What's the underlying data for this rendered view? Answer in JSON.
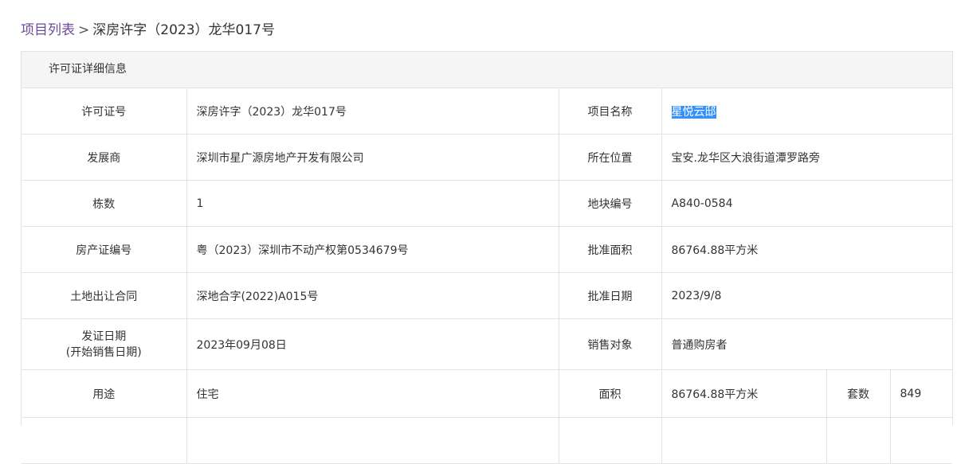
{
  "breadcrumb": {
    "link": "项目列表",
    "separator": ">",
    "current": "深房许字（2023）龙华017号"
  },
  "panel": {
    "title": "许可证详细信息"
  },
  "rows": {
    "permit_no": {
      "label": "许可证号",
      "value": "深房许字（2023）龙华017号"
    },
    "project_name": {
      "label": "项目名称",
      "value": "星悦云邸"
    },
    "developer": {
      "label": "发展商",
      "value": "深圳市星广源房地产开发有限公司"
    },
    "location": {
      "label": "所在位置",
      "value": "宝安.龙华区大浪街道潭罗路旁"
    },
    "buildings": {
      "label": "栋数",
      "value": "1"
    },
    "plot_no": {
      "label": "地块编号",
      "value": "A840-0584"
    },
    "property_cert": {
      "label": "房产证编号",
      "value": "粤（2023）深圳市不动产权第0534679号"
    },
    "approved_area": {
      "label": "批准面积",
      "value": "86764.88平方米"
    },
    "land_contract": {
      "label": "土地出让合同",
      "value": "深地合字(2022)A015号"
    },
    "approved_date": {
      "label": "批准日期",
      "value": "2023/9/8"
    },
    "issue_date": {
      "label_line1": "发证日期",
      "label_line2": "(开始销售日期)",
      "value": "2023年09月08日"
    },
    "sale_target": {
      "label": "销售对象",
      "value": "普通购房者"
    },
    "usage": {
      "label": "用途",
      "value": "住宅"
    },
    "area": {
      "label": "面积",
      "value": "86764.88平方米"
    },
    "units": {
      "label": "套数",
      "value": "849"
    }
  }
}
